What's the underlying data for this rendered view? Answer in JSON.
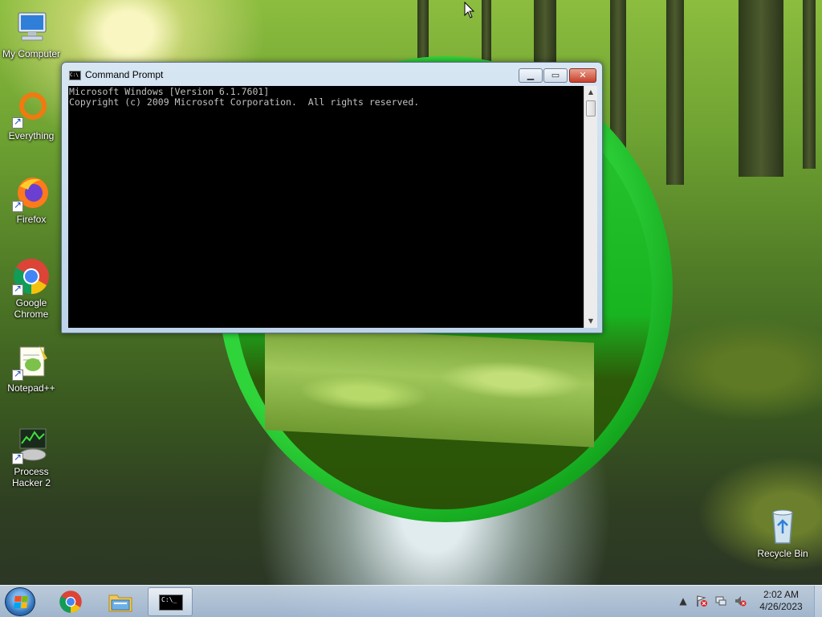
{
  "desktop": {
    "icons": [
      {
        "label": "My Computer",
        "icon": "computer-icon"
      },
      {
        "label": "Everything",
        "icon": "everything-search-icon"
      },
      {
        "label": "Firefox",
        "icon": "firefox-icon"
      },
      {
        "label": "Google Chrome",
        "icon": "chrome-icon"
      },
      {
        "label": "Notepad++",
        "icon": "notepadpp-icon"
      },
      {
        "label": "Process Hacker 2",
        "icon": "process-hacker-icon"
      },
      {
        "label": "Recycle Bin",
        "icon": "recycle-bin-icon"
      }
    ]
  },
  "cmd": {
    "title": "Command Prompt",
    "line1": "Microsoft Windows [Version 6.1.7601]",
    "line2": "Copyright (c) 2009 Microsoft Corporation.  All rights reserved.",
    "minimize": "▁",
    "maximize": "▭",
    "close": "✕"
  },
  "taskbar": {
    "buttons": [
      {
        "name": "chrome",
        "icon": "chrome-icon"
      },
      {
        "name": "explorer",
        "icon": "folder-icon"
      },
      {
        "name": "cmd",
        "icon": "cmd-icon",
        "active": true
      }
    ],
    "tray": {
      "time": "2:02 AM",
      "date": "4/26/2023"
    }
  },
  "colors": {
    "console_bg": "#000000",
    "console_fg": "#c0c0c0",
    "ring_green": "#13a51d"
  }
}
